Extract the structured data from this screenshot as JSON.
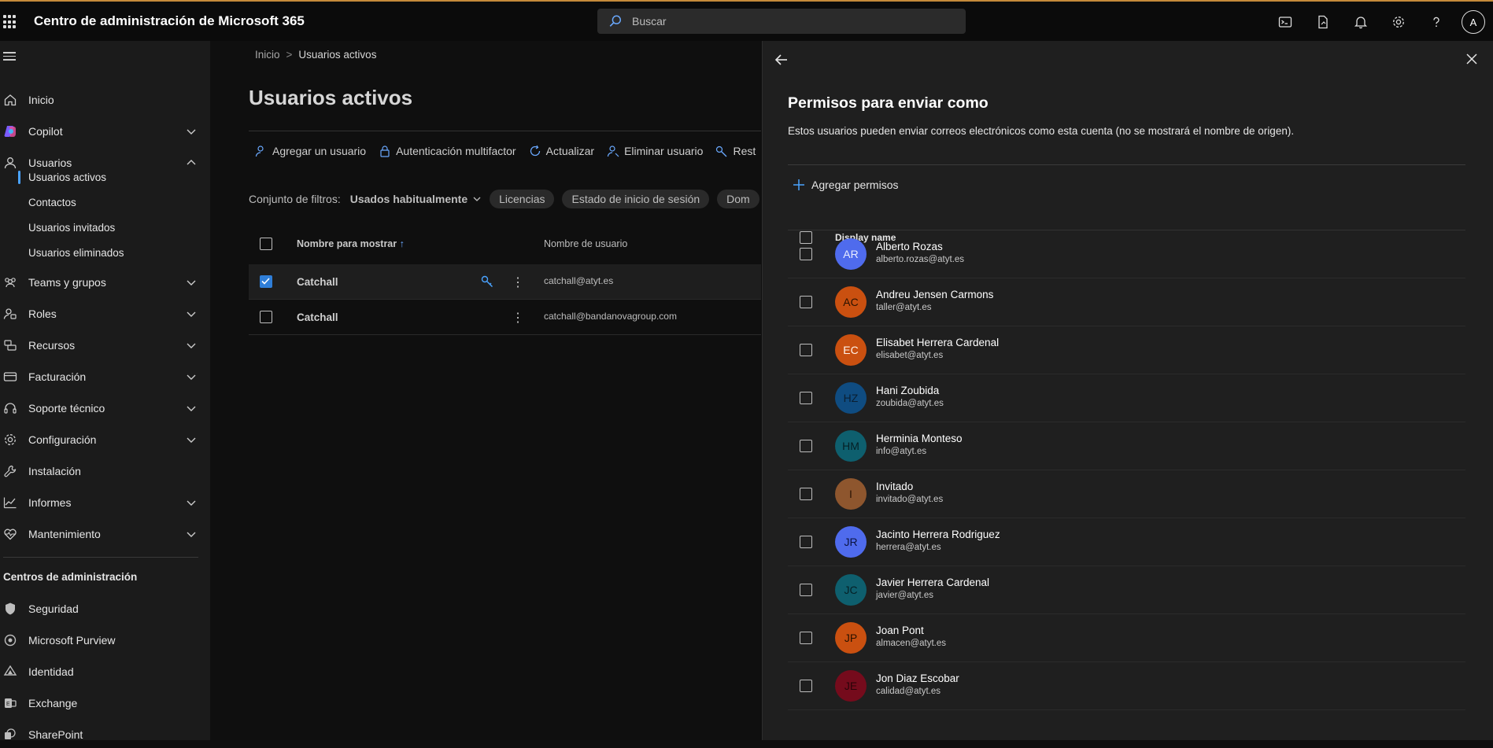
{
  "topbar": {
    "app_title": "Centro de administración de Microsoft 365",
    "search_placeholder": "Buscar",
    "user_initial": "A",
    "icons": [
      "waffle-icon",
      "search-icon",
      "terminal-icon",
      "document-icon",
      "bell-icon",
      "gear-icon",
      "help-icon"
    ]
  },
  "sidebar": {
    "items": [
      {
        "label": "Inicio",
        "icon": "home-icon",
        "expandable": false
      },
      {
        "label": "Copilot",
        "icon": "copilot-icon",
        "expandable": true
      },
      {
        "label": "Usuarios",
        "icon": "user-icon",
        "expandable": true,
        "expanded": true
      },
      {
        "label": "Teams y grupos",
        "icon": "teams-icon",
        "expandable": true
      },
      {
        "label": "Roles",
        "icon": "roles-icon",
        "expandable": true
      },
      {
        "label": "Recursos",
        "icon": "resources-icon",
        "expandable": true
      },
      {
        "label": "Facturación",
        "icon": "billing-icon",
        "expandable": true
      },
      {
        "label": "Soporte técnico",
        "icon": "headset-icon",
        "expandable": true
      },
      {
        "label": "Configuración",
        "icon": "gear-icon",
        "expandable": true
      },
      {
        "label": "Instalación",
        "icon": "wrench-icon",
        "expandable": false
      },
      {
        "label": "Informes",
        "icon": "chart-icon",
        "expandable": true
      },
      {
        "label": "Mantenimiento",
        "icon": "heart-icon",
        "expandable": true
      }
    ],
    "user_subitems": [
      "Usuarios activos",
      "Contactos",
      "Usuarios invitados",
      "Usuarios eliminados"
    ],
    "admin_centers_heading": "Centros de administración",
    "admin_centers": [
      "Seguridad",
      "Microsoft Purview",
      "Identidad",
      "Exchange",
      "SharePoint"
    ]
  },
  "main": {
    "breadcrumb": [
      "Inicio",
      "Usuarios activos"
    ],
    "title": "Usuarios activos",
    "commands": [
      "Agregar un usuario",
      "Autenticación multifactor",
      "Actualizar",
      "Eliminar usuario",
      "Rest"
    ],
    "filter_label": "Conjunto de filtros:",
    "filter_value": "Usados habitualmente",
    "filter_pills": [
      "Licencias",
      "Estado de inicio de sesión",
      "Dom"
    ],
    "columns": [
      "Nombre para mostrar",
      "Nombre de usuario"
    ],
    "sort_indicator": "↑",
    "rows": [
      {
        "name": "Catchall",
        "username": "catchall@atyt.es",
        "selected": true
      },
      {
        "name": "Catchall",
        "username": "catchall@bandanovagroup.com",
        "selected": false
      }
    ]
  },
  "panel": {
    "title": "Permisos para enviar como",
    "description": "Estos usuarios pueden enviar correos electrónicos como esta cuenta (no se mostrará el nombre de origen).",
    "add_label": "Agregar permisos",
    "column_header": "Display name",
    "users": [
      {
        "initials": "AR",
        "name": "Alberto Rozas",
        "email": "alberto.rozas@atyt.es",
        "color": "#4f6bed",
        "text_color": "#e8ecff"
      },
      {
        "initials": "AC",
        "name": "Andreu Jensen Carmons",
        "email": "taller@atyt.es",
        "color": "#ca5010",
        "text_color": "#2a1200"
      },
      {
        "initials": "EC",
        "name": "Elisabet Herrera Cardenal",
        "email": "elisabet@atyt.es",
        "color": "#ca5010",
        "text_color": "#fff3ea"
      },
      {
        "initials": "HZ",
        "name": "Hani Zoubida",
        "email": "zoubida@atyt.es",
        "color": "#0f4c81",
        "text_color": "#0a1f33"
      },
      {
        "initials": "HM",
        "name": "Herminia Monteso",
        "email": "info@atyt.es",
        "color": "#0e5f6e",
        "text_color": "#052026"
      },
      {
        "initials": "I",
        "name": "Invitado",
        "email": "invitado@atyt.es",
        "color": "#8e562e",
        "text_color": "#2a1405"
      },
      {
        "initials": "JR",
        "name": "Jacinto Herrera Rodriguez",
        "email": "herrera@atyt.es",
        "color": "#4f6bed",
        "text_color": "#0b1340"
      },
      {
        "initials": "JC",
        "name": "Javier Herrera Cardenal",
        "email": "javier@atyt.es",
        "color": "#0e5f6e",
        "text_color": "#052026"
      },
      {
        "initials": "JP",
        "name": "Joan Pont",
        "email": "almacen@atyt.es",
        "color": "#ca5010",
        "text_color": "#2a1200"
      },
      {
        "initials": "JE",
        "name": "Jon Diaz Escobar",
        "email": "calidad@atyt.es",
        "color": "#750b1c",
        "text_color": "#2a0409"
      }
    ]
  }
}
